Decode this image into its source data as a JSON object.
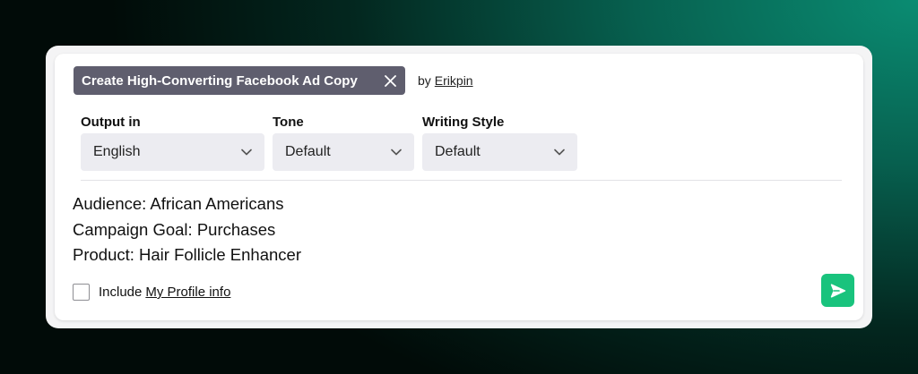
{
  "prompt": {
    "title": "Create High-Converting Facebook Ad Copy",
    "by_label": "by",
    "author": "Erikpin"
  },
  "fields": [
    {
      "label": "Output in",
      "value": "English"
    },
    {
      "label": "Tone",
      "value": "Default"
    },
    {
      "label": "Writing Style",
      "value": "Default"
    }
  ],
  "input": {
    "lines": [
      "Audience: African Americans",
      "Campaign Goal: Purchases",
      "Product: Hair Follicle Enhancer"
    ]
  },
  "footer": {
    "include_label": "Include",
    "profile_link": "My Profile info",
    "checked": false
  },
  "colors": {
    "tag_bg": "#5f5e6e",
    "send_bg": "#19c37d",
    "select_bg": "#ececf1"
  },
  "icons": {
    "close": "close-icon",
    "chevron": "chevron-down-icon",
    "send": "send-icon"
  }
}
